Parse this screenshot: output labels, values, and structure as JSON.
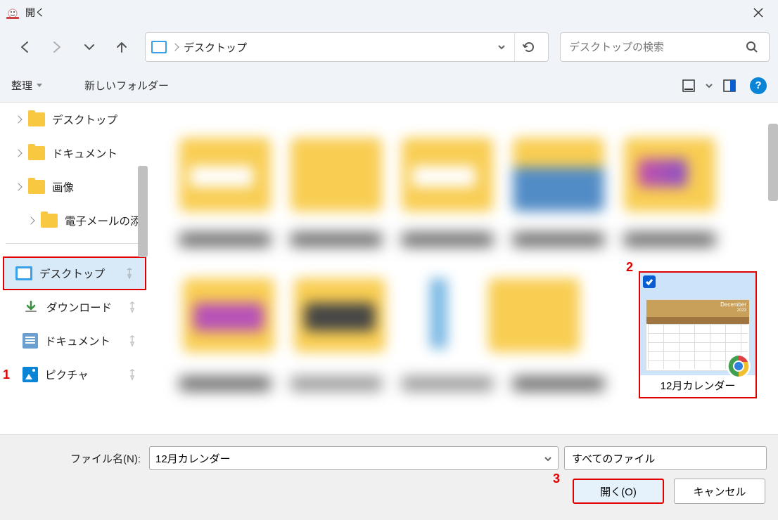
{
  "titlebar": {
    "title": "開く"
  },
  "breadcrumb": {
    "current": "デスクトップ"
  },
  "search": {
    "placeholder": "デスクトップの検索"
  },
  "toolbar": {
    "organize": "整理",
    "new_folder": "新しいフォルダー",
    "help": "?"
  },
  "sidebar": {
    "top_items": [
      {
        "label": "デスクトップ"
      },
      {
        "label": "ドキュメント"
      },
      {
        "label": "画像"
      },
      {
        "label": "電子メールの添付"
      }
    ],
    "pinned_items": [
      {
        "label": "デスクトップ",
        "selected": true
      },
      {
        "label": "ダウンロード"
      },
      {
        "label": "ドキュメント"
      },
      {
        "label": "ピクチャ"
      }
    ]
  },
  "selected_file": {
    "name": "12月カレンダー",
    "calendar_month": "December",
    "calendar_year": "2023"
  },
  "filename_row": {
    "label": "ファイル名(N):",
    "value": "12月カレンダー",
    "filter": "すべてのファイル"
  },
  "buttons": {
    "open": "開く(O)",
    "cancel": "キャンセル"
  },
  "annotations": {
    "a1": "1",
    "a2": "2",
    "a3": "3"
  }
}
